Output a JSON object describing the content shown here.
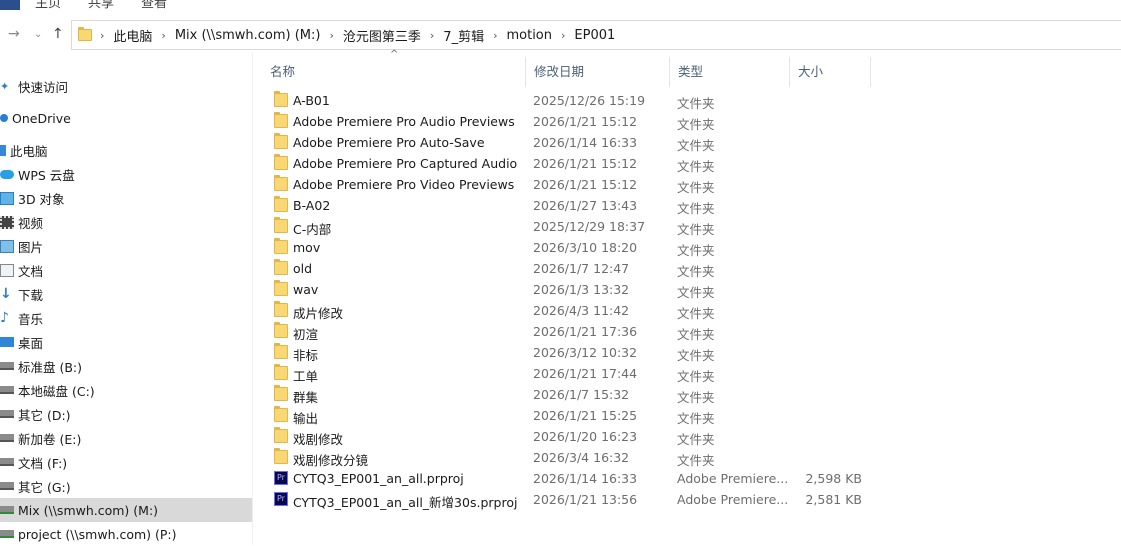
{
  "ribbon": {
    "tabs": [
      "主页",
      "共享",
      "查看"
    ]
  },
  "address": {
    "crumbs": [
      "此电脑",
      "Mix (\\\\smwh.com) (M:)",
      "沧元图第三季",
      "7_剪辑",
      "motion",
      "EP001"
    ]
  },
  "sidebar": {
    "items": [
      {
        "label": "快速访问",
        "icon": "star-icon"
      },
      {
        "label": "OneDrive",
        "icon": "cloud-icon"
      },
      {
        "label": "此电脑",
        "icon": "computer-icon"
      },
      {
        "label": "WPS 云盘",
        "icon": "cloud-icon"
      },
      {
        "label": "3D 对象",
        "icon": "cube-icon"
      },
      {
        "label": "视频",
        "icon": "video-icon"
      },
      {
        "label": "图片",
        "icon": "picture-icon"
      },
      {
        "label": "文档",
        "icon": "document-icon"
      },
      {
        "label": "下载",
        "icon": "download-icon"
      },
      {
        "label": "音乐",
        "icon": "music-icon"
      },
      {
        "label": "桌面",
        "icon": "desktop-icon"
      },
      {
        "label": "标准盘 (B:)",
        "icon": "drive-icon"
      },
      {
        "label": "本地磁盘 (C:)",
        "icon": "drive-icon"
      },
      {
        "label": "其它 (D:)",
        "icon": "drive-icon"
      },
      {
        "label": "新加卷 (E:)",
        "icon": "drive-icon"
      },
      {
        "label": "文档 (F:)",
        "icon": "drive-icon"
      },
      {
        "label": "其它 (G:)",
        "icon": "drive-icon"
      },
      {
        "label": "Mix (\\\\smwh.com) (M:)",
        "icon": "network-drive-icon",
        "selected": true
      },
      {
        "label": "project (\\\\smwh.com) (P:)",
        "icon": "network-drive-icon"
      }
    ]
  },
  "columns": {
    "name": "名称",
    "date": "修改日期",
    "type": "类型",
    "size": "大小"
  },
  "files": [
    {
      "name": "A-B01",
      "date": "2025/12/26 15:19",
      "type": "文件夹",
      "size": "",
      "icon": "folder-icon"
    },
    {
      "name": "Adobe Premiere Pro Audio Previews",
      "date": "2026/1/21 15:12",
      "type": "文件夹",
      "size": "",
      "icon": "folder-icon"
    },
    {
      "name": "Adobe Premiere Pro Auto-Save",
      "date": "2026/1/14 16:33",
      "type": "文件夹",
      "size": "",
      "icon": "folder-icon"
    },
    {
      "name": "Adobe Premiere Pro Captured Audio",
      "date": "2026/1/21 15:12",
      "type": "文件夹",
      "size": "",
      "icon": "folder-icon"
    },
    {
      "name": "Adobe Premiere Pro Video Previews",
      "date": "2026/1/21 15:12",
      "type": "文件夹",
      "size": "",
      "icon": "folder-icon"
    },
    {
      "name": "B-A02",
      "date": "2026/1/27 13:43",
      "type": "文件夹",
      "size": "",
      "icon": "folder-icon"
    },
    {
      "name": "C-内部",
      "date": "2025/12/29 18:37",
      "type": "文件夹",
      "size": "",
      "icon": "folder-icon"
    },
    {
      "name": "mov",
      "date": "2026/3/10 18:20",
      "type": "文件夹",
      "size": "",
      "icon": "folder-icon"
    },
    {
      "name": "old",
      "date": "2026/1/7 12:47",
      "type": "文件夹",
      "size": "",
      "icon": "folder-icon"
    },
    {
      "name": "wav",
      "date": "2026/1/3 13:32",
      "type": "文件夹",
      "size": "",
      "icon": "folder-icon"
    },
    {
      "name": "成片修改",
      "date": "2026/4/3 11:42",
      "type": "文件夹",
      "size": "",
      "icon": "folder-icon"
    },
    {
      "name": "初渲",
      "date": "2026/1/21 17:36",
      "type": "文件夹",
      "size": "",
      "icon": "folder-icon"
    },
    {
      "name": "非标",
      "date": "2026/3/12 10:32",
      "type": "文件夹",
      "size": "",
      "icon": "folder-icon"
    },
    {
      "name": "工单",
      "date": "2026/1/21 17:44",
      "type": "文件夹",
      "size": "",
      "icon": "folder-icon"
    },
    {
      "name": "群集",
      "date": "2026/1/7 15:32",
      "type": "文件夹",
      "size": "",
      "icon": "folder-icon"
    },
    {
      "name": "输出",
      "date": "2026/1/21 15:25",
      "type": "文件夹",
      "size": "",
      "icon": "folder-icon"
    },
    {
      "name": "戏剧修改",
      "date": "2026/1/20 16:23",
      "type": "文件夹",
      "size": "",
      "icon": "folder-icon"
    },
    {
      "name": "戏剧修改分镜",
      "date": "2026/3/4 16:32",
      "type": "文件夹",
      "size": "",
      "icon": "folder-icon"
    },
    {
      "name": "CYTQ3_EP001_an_all.prproj",
      "date": "2026/1/14 16:33",
      "type": "Adobe Premiere...",
      "size": "2,598 KB",
      "icon": "premiere-project-icon"
    },
    {
      "name": "CYTQ3_EP001_an_all_新增30s.prproj",
      "date": "2026/1/21 13:56",
      "type": "Adobe Premiere...",
      "size": "2,581 KB",
      "icon": "premiere-project-icon"
    }
  ]
}
